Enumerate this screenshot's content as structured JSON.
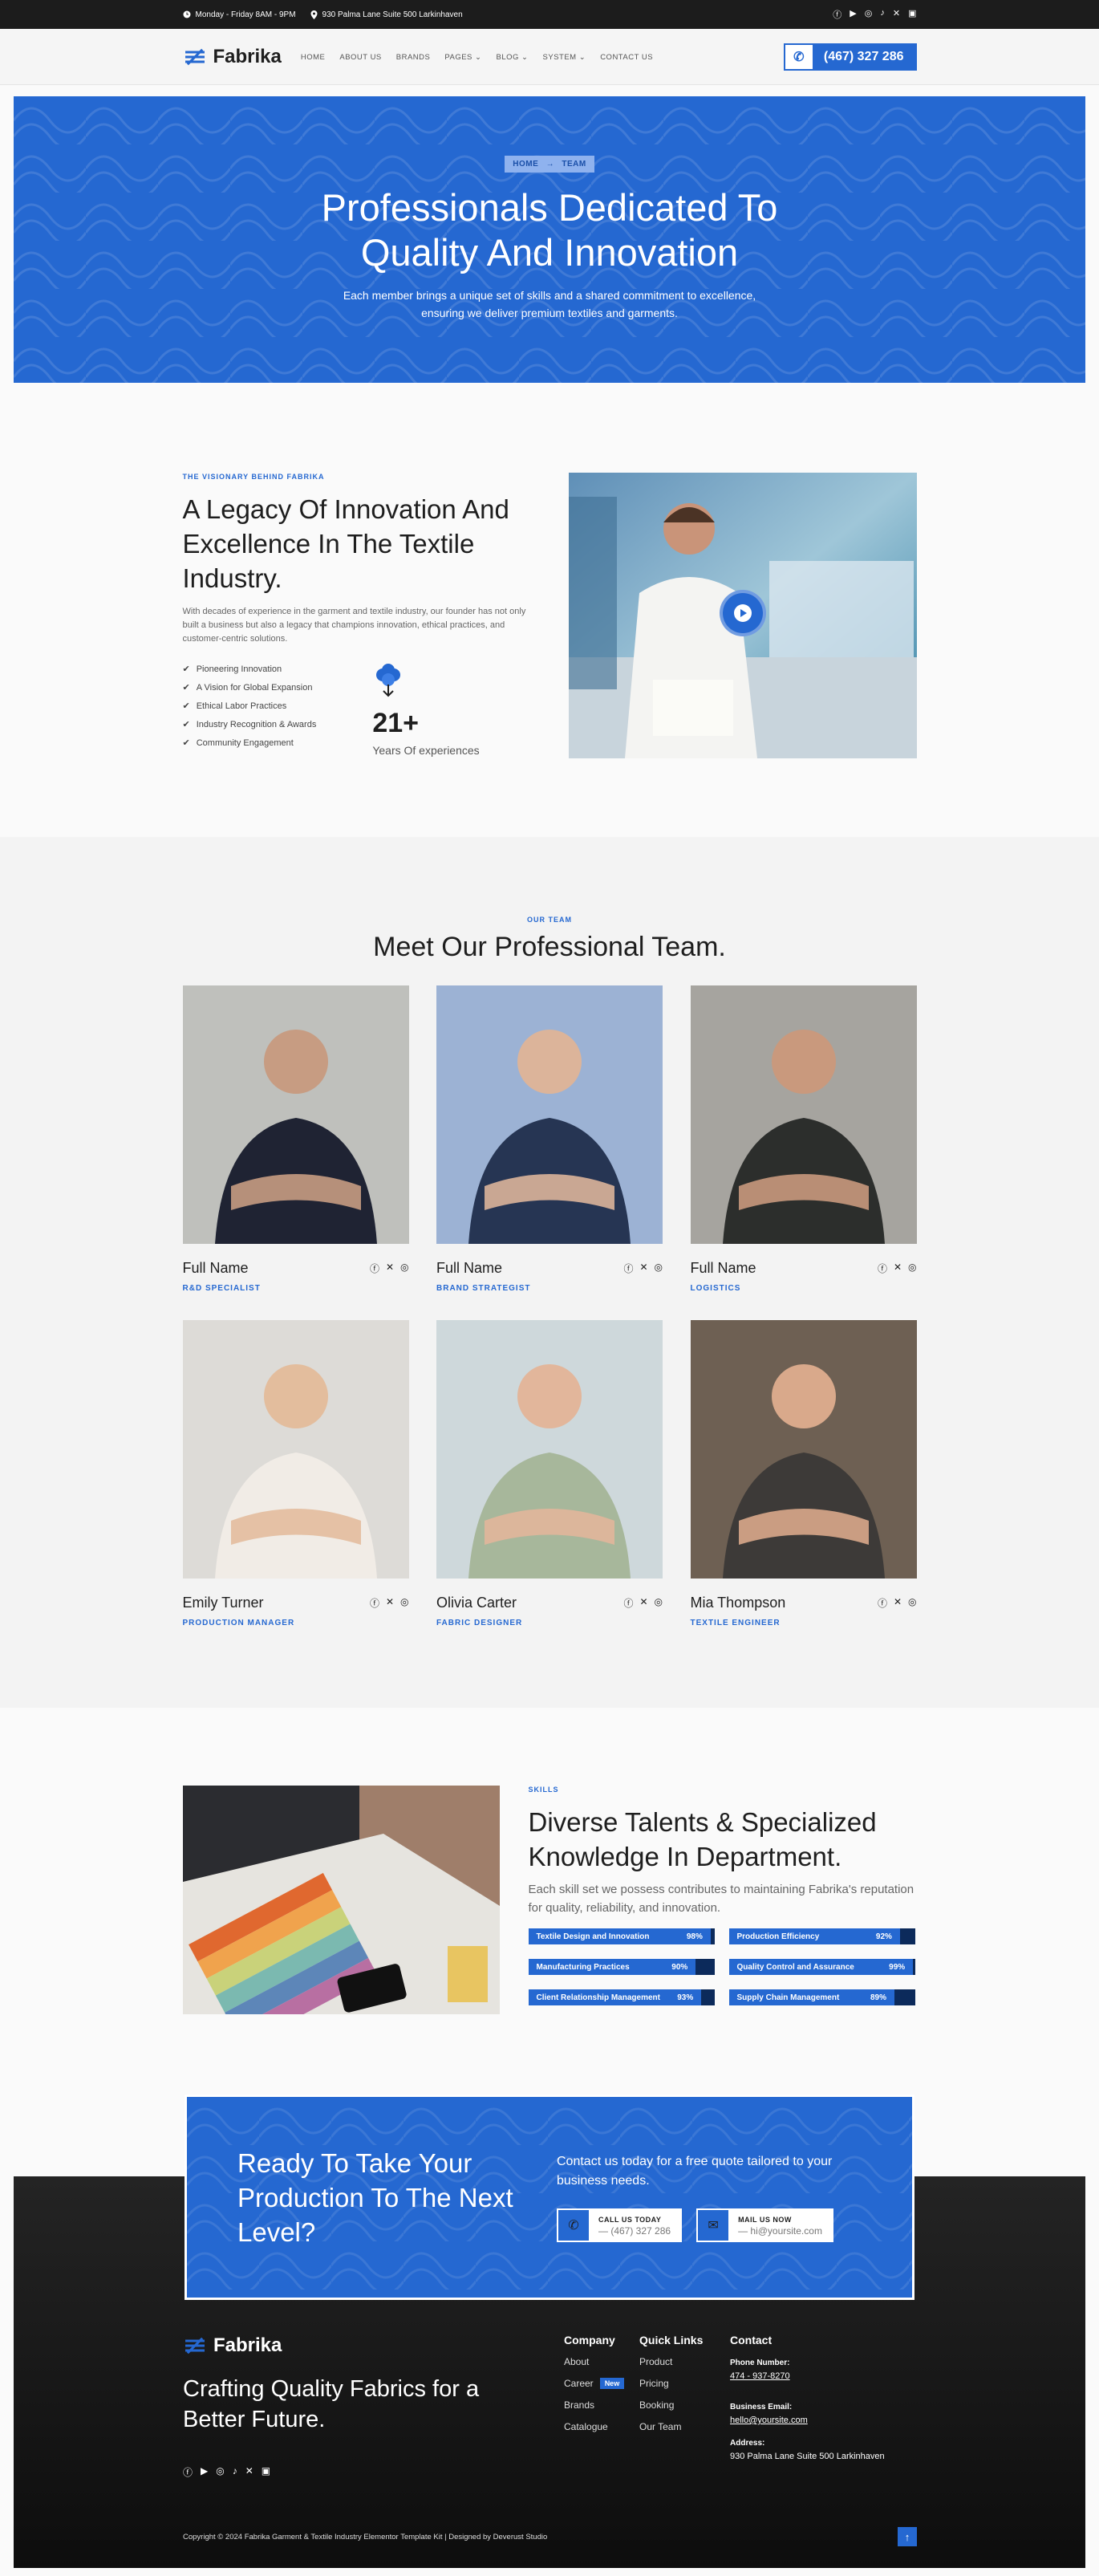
{
  "topbar": {
    "hours": "Monday - Friday 8AM - 9PM",
    "address": "930 Palma Lane Suite 500 Larkinhaven"
  },
  "header": {
    "logo": "Fabrika",
    "nav": [
      "HOME",
      "ABOUT US",
      "BRANDS",
      "PAGES",
      "BLOG",
      "SYSTEM",
      "CONTACT US"
    ],
    "phone": "(467) 327 286"
  },
  "hero": {
    "crumb_home": "HOME",
    "crumb_sep": "→",
    "crumb_current": "TEAM",
    "title_1": "Professionals Dedicated To",
    "title_2": "Quality And Innovation",
    "text": "Each member brings a unique set of skills and a shared commitment to excellence, ensuring we deliver premium textiles and garments."
  },
  "legacy": {
    "eyebrow": "THE VISIONARY BEHIND FABRIKA",
    "title": "A Legacy Of Innovation And Excellence In The Textile Industry.",
    "desc": "With decades of experience in the garment and textile industry, our founder has not only built a business but also a legacy that champions innovation, ethical practices, and customer-centric solutions.",
    "checks": [
      "Pioneering Innovation",
      "A Vision for Global Expansion",
      "Ethical Labor Practices",
      "Industry Recognition & Awards",
      "Community Engagement"
    ],
    "exp_num": "21+",
    "exp_label": "Years Of experiences"
  },
  "team": {
    "eyebrow": "OUR TEAM",
    "title": "Meet Our Professional Team.",
    "members": [
      {
        "name": "Full Name",
        "role": "R&D SPECIALIST"
      },
      {
        "name": "Full Name",
        "role": "BRAND STRATEGIST"
      },
      {
        "name": "Full Name",
        "role": "LOGISTICS"
      },
      {
        "name": "Emily Turner",
        "role": "PRODUCTION MANAGER"
      },
      {
        "name": "Olivia Carter",
        "role": "FABRIC DESIGNER"
      },
      {
        "name": "Mia Thompson",
        "role": "TEXTILE ENGINEER"
      }
    ]
  },
  "skills": {
    "eyebrow": "SKILLS",
    "title": "Diverse Talents & Specialized Knowledge In Department.",
    "desc": "Each skill set we possess contributes to maintaining Fabrika's reputation for quality, reliability, and innovation.",
    "items": [
      {
        "label": "Textile Design and Innovation",
        "value": "98%",
        "pct": 98
      },
      {
        "label": "Production Efficiency",
        "value": "92%",
        "pct": 92
      },
      {
        "label": "Manufacturing Practices",
        "value": "90%",
        "pct": 90
      },
      {
        "label": "Quality Control and Assurance",
        "value": "99%",
        "pct": 99
      },
      {
        "label": "Client Relationship Management",
        "value": "93%",
        "pct": 93
      },
      {
        "label": "Supply Chain Management",
        "value": "89%",
        "pct": 89
      }
    ]
  },
  "cta": {
    "title": "Ready To Take Your Production To The Next Level?",
    "text": "Contact us today for a free quote tailored to your business needs.",
    "call_label": "CALL US TODAY",
    "call_value": "— (467) 327 286",
    "mail_label": "MAIL US NOW",
    "mail_value": "— hi@yoursite.com"
  },
  "footer": {
    "logo": "Fabrika",
    "tagline": "Crafting Quality Fabrics for a Better Future.",
    "company_title": "Company",
    "company": [
      "About",
      "Career",
      "Brands",
      "Catalogue"
    ],
    "career_badge": "New",
    "links_title": "Quick Links",
    "links": [
      "Product",
      "Pricing",
      "Booking",
      "Our Team"
    ],
    "contact_title": "Contact",
    "phone_label": "Phone Number:",
    "phone": "474 - 937-8270",
    "email_label": "Business Email:",
    "email": "hello@yoursite.com",
    "address_label": "Address:",
    "address": "930 Palma Lane Suite 500 Larkinhaven",
    "copyright": "Copyright © 2024 Fabrika Garment & Textile Industry Elementor Template Kit | Designed by Deverust Studio"
  },
  "colors": {
    "accent": "#2568d1",
    "dark": "#1c1c1c"
  }
}
